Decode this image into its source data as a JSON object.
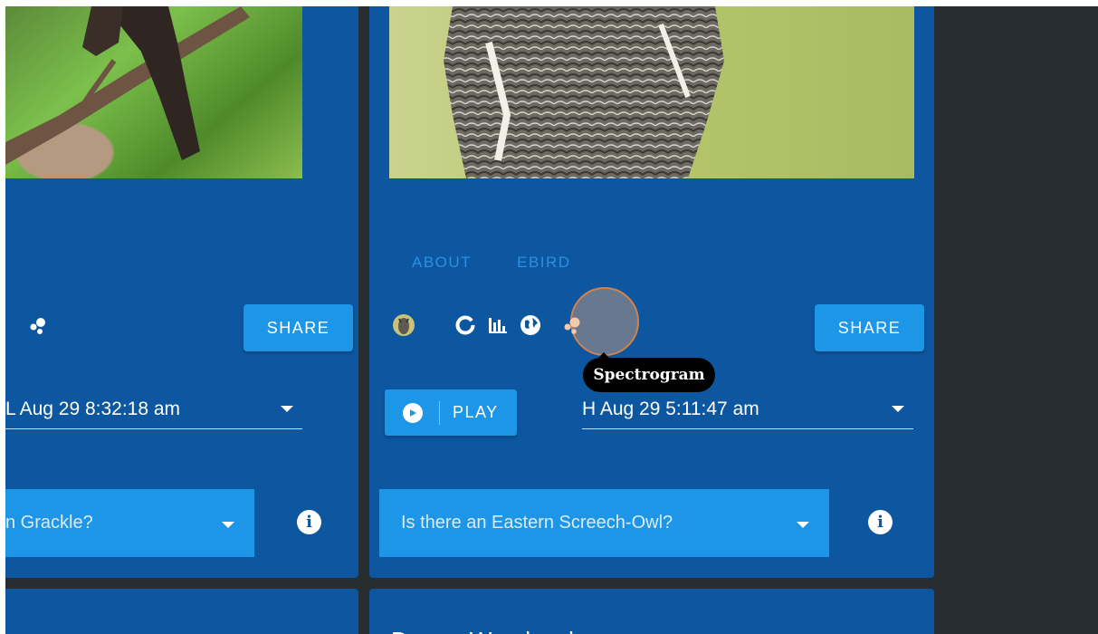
{
  "left_card": {
    "share_label": "SHARE",
    "recording_value": "L Aug 29 8:32:18 am",
    "question_value": "n Grackle?"
  },
  "right_card": {
    "tabs": [
      "ABOUT",
      "EBIRD"
    ],
    "icons": [
      "owl-avatar-icon",
      "donut-chart-icon",
      "bar-chart-icon",
      "globe-icon",
      "spectrogram-icon"
    ],
    "share_label": "SHARE",
    "play_label": "PLAY",
    "recording_value": "H Aug 29 5:11:47 am",
    "question_value": "Is there an Eastern Screech-Owl?",
    "tooltip": "Spectrogram"
  },
  "next_card": {
    "title": "Downy Woodpecker"
  },
  "colors": {
    "card": "#0c57a0",
    "accent": "#1e96e8",
    "background": "#282d32",
    "tab": "#2d8fe0"
  }
}
